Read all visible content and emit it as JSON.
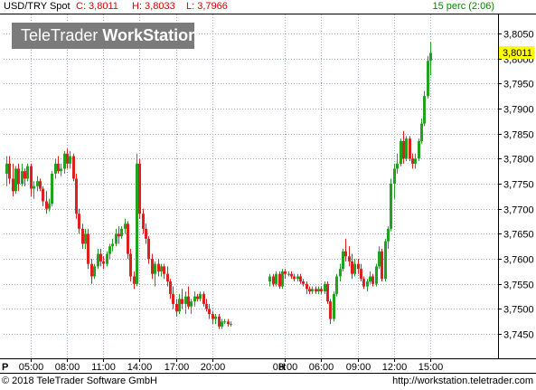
{
  "header": {
    "symbol": "USD/TRY Spot",
    "close_label": "C: 3,8011",
    "high_label": "H: 3,8033",
    "low_label": "L: 3,7966",
    "interval": "15 perc (2:06)"
  },
  "watermark": {
    "brand": "TeleTrader",
    "product": "WorkStation"
  },
  "footer": {
    "copyright": "© 2018 TeleTrader Software GmbH",
    "url": "http://workstation.teletrader.com"
  },
  "colors": {
    "up": "#21a321",
    "down": "#e11f1f",
    "grid": "#9aa6c4",
    "last_price_bg": "#ffff00",
    "header_symbol": "#000000",
    "header_ohl": "#e00000",
    "header_interval": "#008800",
    "watermark_bg": "#7b7b7b"
  },
  "chart_data": {
    "type": "candlestick",
    "last_price": "3,8011",
    "ylim": [
      3.7425,
      3.8075
    ],
    "y_ticks": [
      "3,8050",
      "3,8000",
      "3,7950",
      "3,7900",
      "3,7850",
      "3,7800",
      "3,7750",
      "3,7700",
      "3,7650",
      "3,7600",
      "3,7550",
      "3,7500",
      "3,7450"
    ],
    "x_ticks": [
      "05:00",
      "08:00",
      "11:00",
      "14:00",
      "17:00",
      "20:00",
      "03:00",
      "06:00",
      "09:00",
      "12:00",
      "15:00"
    ],
    "x_markers": [
      "P",
      "H"
    ],
    "candles": [
      [
        3.777,
        3.7805,
        3.7745,
        3.779
      ],
      [
        3.779,
        3.7805,
        3.775,
        3.776
      ],
      [
        3.776,
        3.779,
        3.7725,
        3.7735
      ],
      [
        3.7735,
        3.7785,
        3.773,
        3.778
      ],
      [
        3.778,
        3.779,
        3.7735,
        3.775
      ],
      [
        3.775,
        3.779,
        3.7745,
        3.7775
      ],
      [
        3.7775,
        3.778,
        3.7745,
        3.776
      ],
      [
        3.776,
        3.779,
        3.7755,
        3.7785
      ],
      [
        3.7785,
        3.779,
        3.7725,
        3.774
      ],
      [
        3.774,
        3.7755,
        3.772,
        3.7745
      ],
      [
        3.7745,
        3.7765,
        3.7735,
        3.7755
      ],
      [
        3.7755,
        3.776,
        3.7735,
        3.774
      ],
      [
        3.774,
        3.7745,
        3.7705,
        3.7715
      ],
      [
        3.7715,
        3.7735,
        3.769,
        3.77
      ],
      [
        3.77,
        3.772,
        3.7695,
        3.771
      ],
      [
        3.771,
        3.7775,
        3.7705,
        3.777
      ],
      [
        3.777,
        3.78,
        3.776,
        3.779
      ],
      [
        3.779,
        3.7805,
        3.777,
        3.7775
      ],
      [
        3.7775,
        3.779,
        3.7765,
        3.778
      ],
      [
        3.778,
        3.7815,
        3.777,
        3.781
      ],
      [
        3.781,
        3.782,
        3.778,
        3.779
      ],
      [
        3.779,
        3.7815,
        3.778,
        3.7805
      ],
      [
        3.7805,
        3.781,
        3.7755,
        3.776
      ],
      [
        3.776,
        3.777,
        3.768,
        3.769
      ],
      [
        3.769,
        3.77,
        3.765,
        3.766
      ],
      [
        3.766,
        3.767,
        3.762,
        3.763
      ],
      [
        3.763,
        3.766,
        3.762,
        3.765
      ],
      [
        3.765,
        3.766,
        3.758,
        3.759
      ],
      [
        3.759,
        3.76,
        3.755,
        3.7565
      ],
      [
        3.7565,
        3.759,
        3.756,
        3.7585
      ],
      [
        3.7585,
        3.762,
        3.758,
        3.761
      ],
      [
        3.761,
        3.762,
        3.7585,
        3.7595
      ],
      [
        3.7595,
        3.7605,
        3.758,
        3.759
      ],
      [
        3.759,
        3.7615,
        3.7585,
        3.761
      ],
      [
        3.761,
        3.763,
        3.76,
        3.7625
      ],
      [
        3.7625,
        3.764,
        3.7615,
        3.763
      ],
      [
        3.763,
        3.766,
        3.7625,
        3.765
      ],
      [
        3.765,
        3.7665,
        3.763,
        3.7645
      ],
      [
        3.7645,
        3.7665,
        3.764,
        3.766
      ],
      [
        3.766,
        3.768,
        3.765,
        3.767
      ],
      [
        3.767,
        3.7675,
        3.76,
        3.761
      ],
      [
        3.761,
        3.762,
        3.7555,
        3.7565
      ],
      [
        3.7565,
        3.7575,
        3.754,
        3.755
      ],
      [
        3.755,
        3.781,
        3.7545,
        3.779
      ],
      [
        3.779,
        3.78,
        3.768,
        3.769
      ],
      [
        3.769,
        3.77,
        3.765,
        3.766
      ],
      [
        3.766,
        3.767,
        3.763,
        3.764
      ],
      [
        3.764,
        3.7645,
        3.759,
        3.76
      ],
      [
        3.76,
        3.761,
        3.756,
        3.757
      ],
      [
        3.757,
        3.7595,
        3.7545,
        3.759
      ],
      [
        3.759,
        3.76,
        3.7565,
        3.7575
      ],
      [
        3.7575,
        3.759,
        3.7565,
        3.7585
      ],
      [
        3.7585,
        3.759,
        3.756,
        3.757
      ],
      [
        3.757,
        3.7585,
        3.7545,
        3.7555
      ],
      [
        3.7555,
        3.756,
        3.752,
        3.753
      ],
      [
        3.753,
        3.7545,
        3.75,
        3.751
      ],
      [
        3.751,
        3.752,
        3.7485,
        3.7495
      ],
      [
        3.7495,
        3.753,
        3.749,
        3.752
      ],
      [
        3.752,
        3.754,
        3.75,
        3.751
      ],
      [
        3.751,
        3.7535,
        3.749,
        3.7525
      ],
      [
        3.7525,
        3.7545,
        3.75,
        3.7505
      ],
      [
        3.7505,
        3.752,
        3.749,
        3.7515
      ],
      [
        3.7515,
        3.7535,
        3.7505,
        3.7525
      ],
      [
        3.7525,
        3.753,
        3.7515,
        3.752
      ],
      [
        3.752,
        3.7535,
        3.7515,
        3.753
      ],
      [
        3.753,
        3.7535,
        3.7505,
        3.751
      ],
      [
        3.751,
        3.752,
        3.7495,
        3.75
      ],
      [
        3.75,
        3.751,
        3.748,
        3.749
      ],
      [
        3.749,
        3.7495,
        3.747,
        3.748
      ],
      [
        3.748,
        3.749,
        3.747,
        3.7485
      ],
      [
        3.7485,
        3.749,
        3.746,
        3.7465
      ],
      [
        3.7465,
        3.748,
        3.746,
        3.7475
      ],
      [
        3.7475,
        3.748,
        3.747,
        3.7475
      ],
      [
        3.7475,
        3.748,
        3.7465,
        3.747
      ],
      [
        3.747,
        3.7475,
        3.7465,
        3.747
      ],
      null,
      null,
      null,
      null,
      null,
      null,
      null,
      null,
      null,
      null,
      null,
      null,
      [
        3.7555,
        3.757,
        3.7545,
        3.7565
      ],
      [
        3.7565,
        3.757,
        3.7545,
        3.755
      ],
      [
        3.755,
        3.7575,
        3.7545,
        3.757
      ],
      [
        3.757,
        3.7575,
        3.754,
        3.7545
      ],
      [
        3.7545,
        3.758,
        3.754,
        3.7575
      ],
      [
        3.7575,
        3.758,
        3.756,
        3.757
      ],
      [
        3.757,
        3.7575,
        3.7565,
        3.757
      ],
      [
        3.757,
        3.7575,
        3.756,
        3.7565
      ],
      [
        3.7565,
        3.757,
        3.7555,
        3.756
      ],
      [
        3.756,
        3.757,
        3.7555,
        3.7565
      ],
      [
        3.7565,
        3.757,
        3.755,
        3.7555
      ],
      [
        3.7555,
        3.756,
        3.7545,
        3.755
      ],
      [
        3.755,
        3.7555,
        3.753,
        3.754
      ],
      [
        3.754,
        3.7545,
        3.753,
        3.7535
      ],
      [
        3.7535,
        3.7545,
        3.753,
        3.754
      ],
      [
        3.754,
        3.7545,
        3.753,
        3.7535
      ],
      [
        3.7535,
        3.7545,
        3.753,
        3.754
      ],
      [
        3.754,
        3.7545,
        3.753,
        3.7535
      ],
      [
        3.7535,
        3.7555,
        3.753,
        3.755
      ],
      [
        3.755,
        3.7555,
        3.751,
        3.7515
      ],
      [
        3.7515,
        3.752,
        3.747,
        3.748
      ],
      [
        3.748,
        3.7535,
        3.7475,
        3.753
      ],
      [
        3.753,
        3.757,
        3.7525,
        3.7565
      ],
      [
        3.7565,
        3.759,
        3.7555,
        3.758
      ],
      [
        3.758,
        3.762,
        3.7575,
        3.7615
      ],
      [
        3.7615,
        3.764,
        3.7595,
        3.7605
      ],
      [
        3.7605,
        3.7625,
        3.7585,
        3.7595
      ],
      [
        3.7595,
        3.761,
        3.756,
        3.757
      ],
      [
        3.757,
        3.76,
        3.7565,
        3.759
      ],
      [
        3.759,
        3.76,
        3.757,
        3.758
      ],
      [
        3.758,
        3.759,
        3.7555,
        3.756
      ],
      [
        3.756,
        3.7565,
        3.754,
        3.7545
      ],
      [
        3.7545,
        3.756,
        3.7535,
        3.7555
      ],
      [
        3.7555,
        3.7575,
        3.755,
        3.7565
      ],
      [
        3.7565,
        3.757,
        3.7545,
        3.755
      ],
      [
        3.755,
        3.759,
        3.7545,
        3.7585
      ],
      [
        3.7585,
        3.7625,
        3.758,
        3.7615
      ],
      [
        3.7615,
        3.762,
        3.7555,
        3.756
      ],
      [
        3.756,
        3.764,
        3.7555,
        3.7635
      ],
      [
        3.7635,
        3.7665,
        3.762,
        3.766
      ],
      [
        3.766,
        3.776,
        3.7655,
        3.775
      ],
      [
        3.775,
        3.779,
        3.772,
        3.778
      ],
      [
        3.778,
        3.781,
        3.777,
        3.779
      ],
      [
        3.779,
        3.784,
        3.7785,
        3.7835
      ],
      [
        3.7835,
        3.7855,
        3.779,
        3.78
      ],
      [
        3.78,
        3.7845,
        3.7795,
        3.784
      ],
      [
        3.784,
        3.7845,
        3.7795,
        3.78
      ],
      [
        3.78,
        3.781,
        3.778,
        3.779
      ],
      [
        3.779,
        3.781,
        3.778,
        3.78
      ],
      [
        3.78,
        3.784,
        3.7795,
        3.7835
      ],
      [
        3.7835,
        3.788,
        3.783,
        3.787
      ],
      [
        3.787,
        3.7935,
        3.7865,
        3.7925
      ],
      [
        3.7925,
        3.8005,
        3.792,
        3.7995
      ],
      [
        3.7995,
        3.8033,
        3.7966,
        3.8011
      ]
    ]
  }
}
